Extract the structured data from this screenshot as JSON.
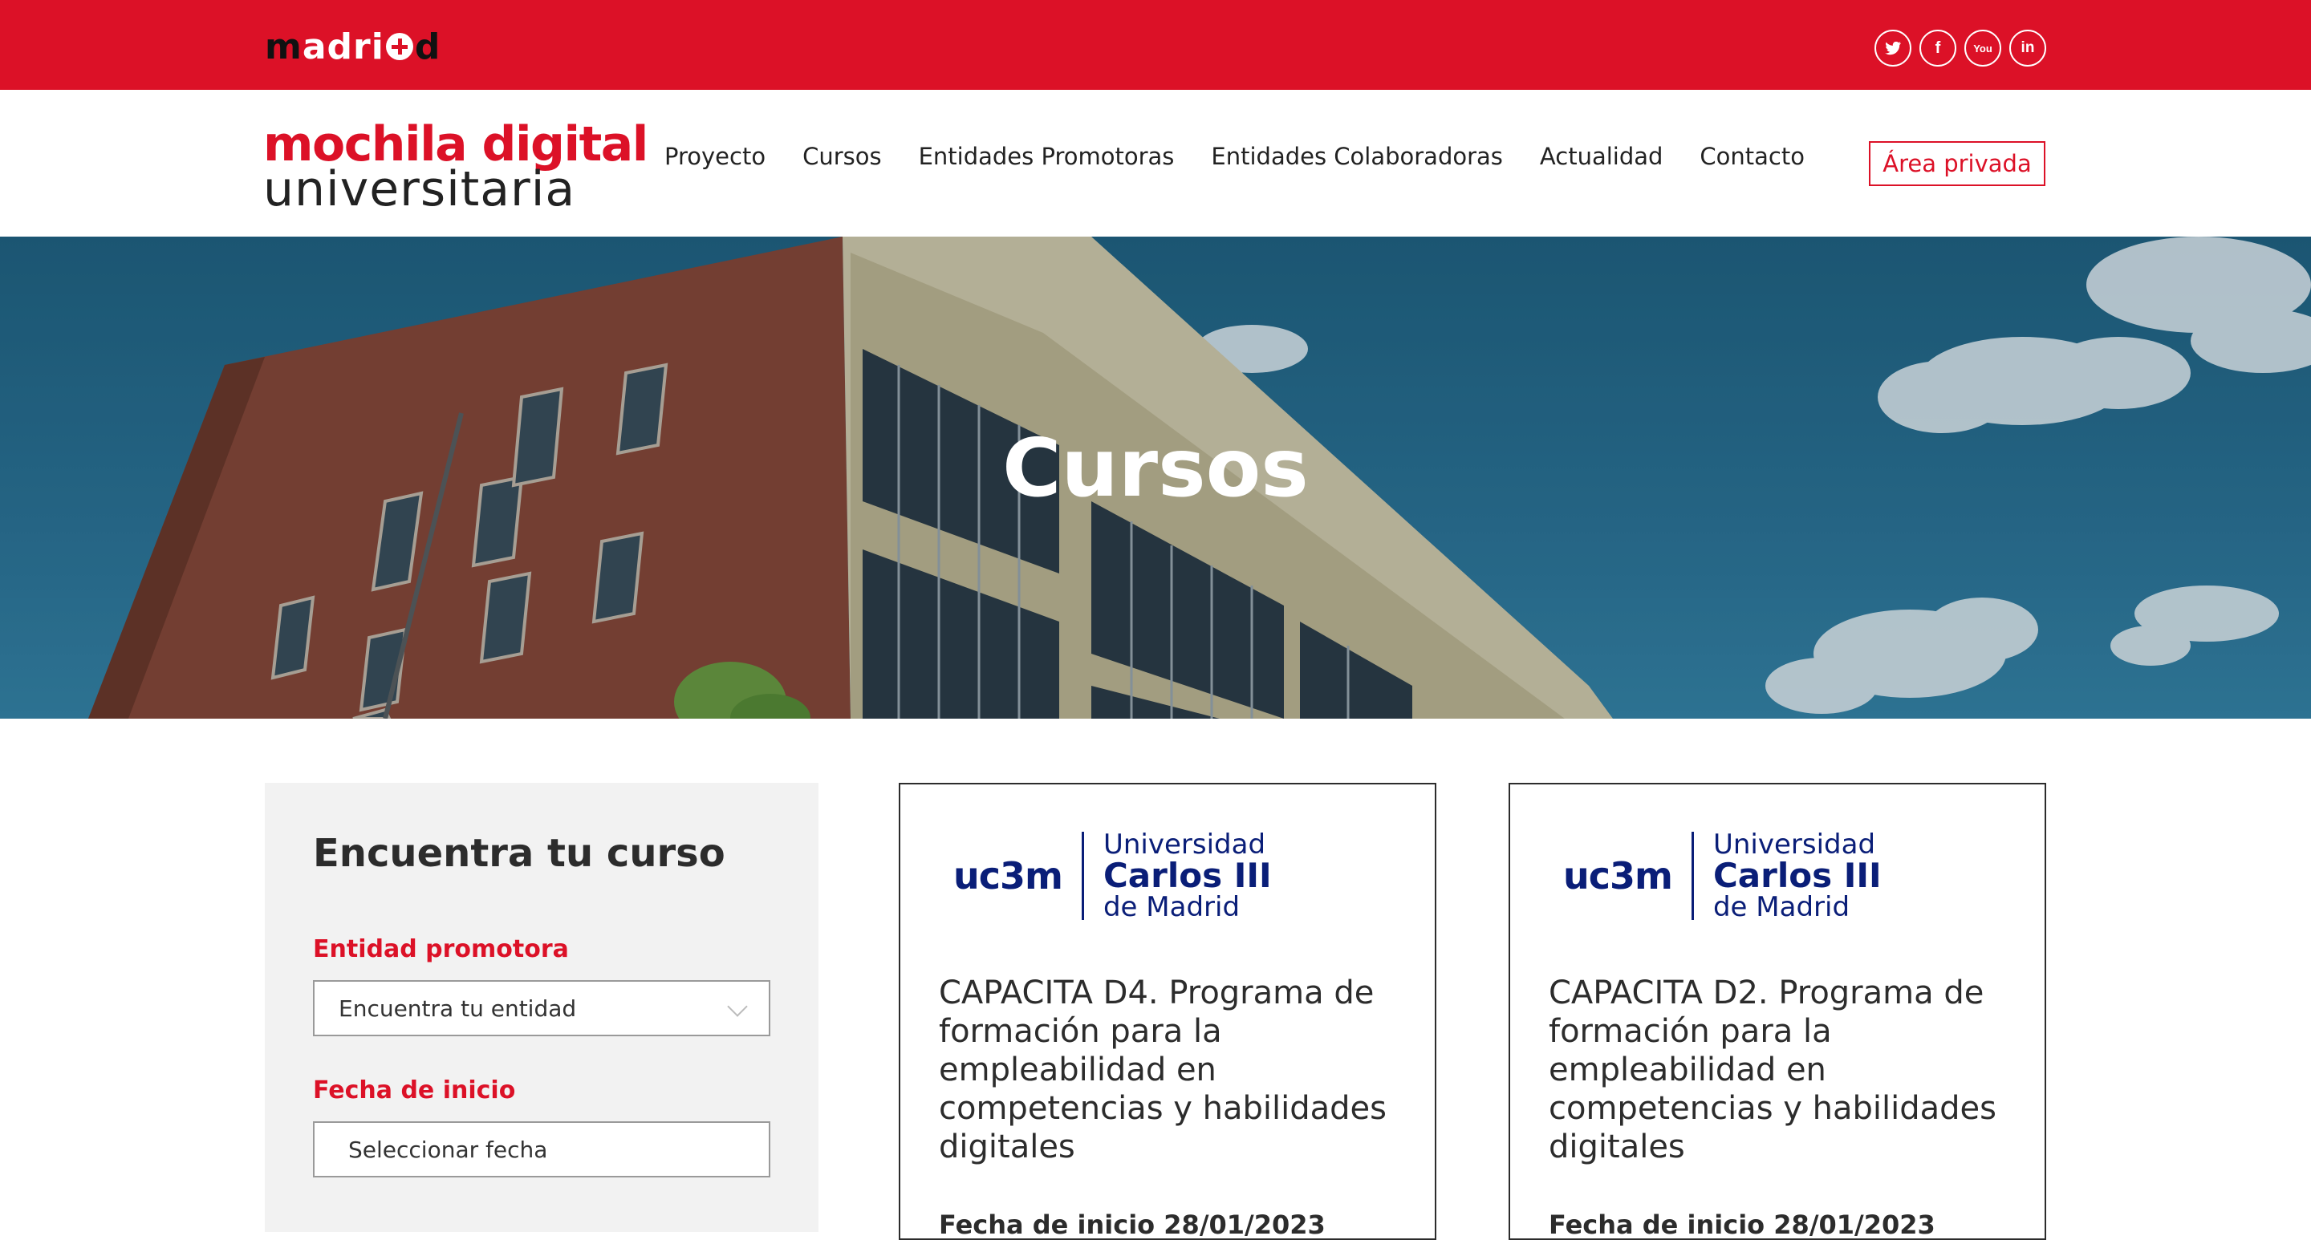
{
  "topbar": {
    "logo_prefix": "m",
    "logo_mid": "adri",
    "logo_suffix": "d",
    "socials": [
      {
        "name": "twitter-icon"
      },
      {
        "name": "facebook-icon",
        "glyph": "f"
      },
      {
        "name": "youtube-icon",
        "glyph": "You"
      },
      {
        "name": "linkedin-icon",
        "glyph": "in"
      }
    ]
  },
  "header": {
    "brand_line1": "mochila digital",
    "brand_line2": "universitaria",
    "nav": [
      "Proyecto",
      "Cursos",
      "Entidades Promotoras",
      "Entidades Colaboradoras",
      "Actualidad",
      "Contacto"
    ],
    "private_area": "Área privada"
  },
  "hero": {
    "title": "Cursos"
  },
  "filter": {
    "title": "Encuentra tu curso",
    "entity_label": "Entidad promotora",
    "entity_value": "Encuentra tu entidad",
    "date_label": "Fecha de inicio",
    "date_value": "Seleccionar fecha"
  },
  "courses": [
    {
      "university_short": "uc3m",
      "university_line1": "Universidad",
      "university_line2": "Carlos III",
      "university_line3": "de Madrid",
      "title": "CAPACITA D4. Programa de formación para la empleabilidad en competencias y habilidades digitales",
      "start_date": "Fecha de inicio 28/01/2023"
    },
    {
      "university_short": "uc3m",
      "university_line1": "Universidad",
      "university_line2": "Carlos III",
      "university_line3": "de Madrid",
      "title": "CAPACITA D2. Programa de formación para la empleabilidad en competencias y habilidades digitales",
      "start_date": "Fecha de inicio 28/01/2023"
    }
  ],
  "colors": {
    "brand_red": "#dc1127",
    "uc3m_blue": "#0a1e78",
    "panel_gray": "#f2f2f2"
  }
}
